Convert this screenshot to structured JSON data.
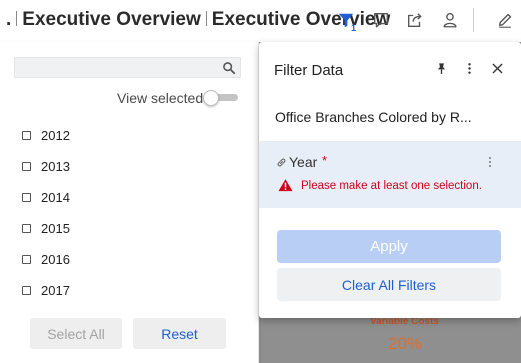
{
  "header": {
    "title_prefix": ".",
    "title_1": "Executive Overview",
    "title_2": "Executive Overview",
    "filter_count": "1",
    "icons": [
      "filter-icon",
      "comment-icon",
      "share-icon",
      "user-icon",
      "edit-icon"
    ],
    "accent_color": "#1f5fd1"
  },
  "left_panel": {
    "search": {
      "value": "",
      "placeholder": ""
    },
    "view_selected_label": "View selected",
    "view_selected_on": false,
    "years": [
      {
        "label": "2012",
        "checked": false
      },
      {
        "label": "2013",
        "checked": false
      },
      {
        "label": "2014",
        "checked": false
      },
      {
        "label": "2015",
        "checked": false
      },
      {
        "label": "2016",
        "checked": false
      },
      {
        "label": "2017",
        "checked": false
      }
    ],
    "select_all_label": "Select All",
    "reset_label": "Reset"
  },
  "filter_panel": {
    "title": "Filter Data",
    "subtitle": "Office Branches Colored by R...",
    "year_filter": {
      "label": "Year",
      "required_marker": "*",
      "warning": "Please make at least one selection."
    },
    "apply_label": "Apply",
    "clear_label": "Clear All Filters"
  },
  "background": {
    "kpi_label": "Variable Costs",
    "kpi_value": "20%"
  },
  "colors": {
    "warning": "#d0021b",
    "apply_disabled": "#b8cef5",
    "kpi": "#d8722f"
  }
}
